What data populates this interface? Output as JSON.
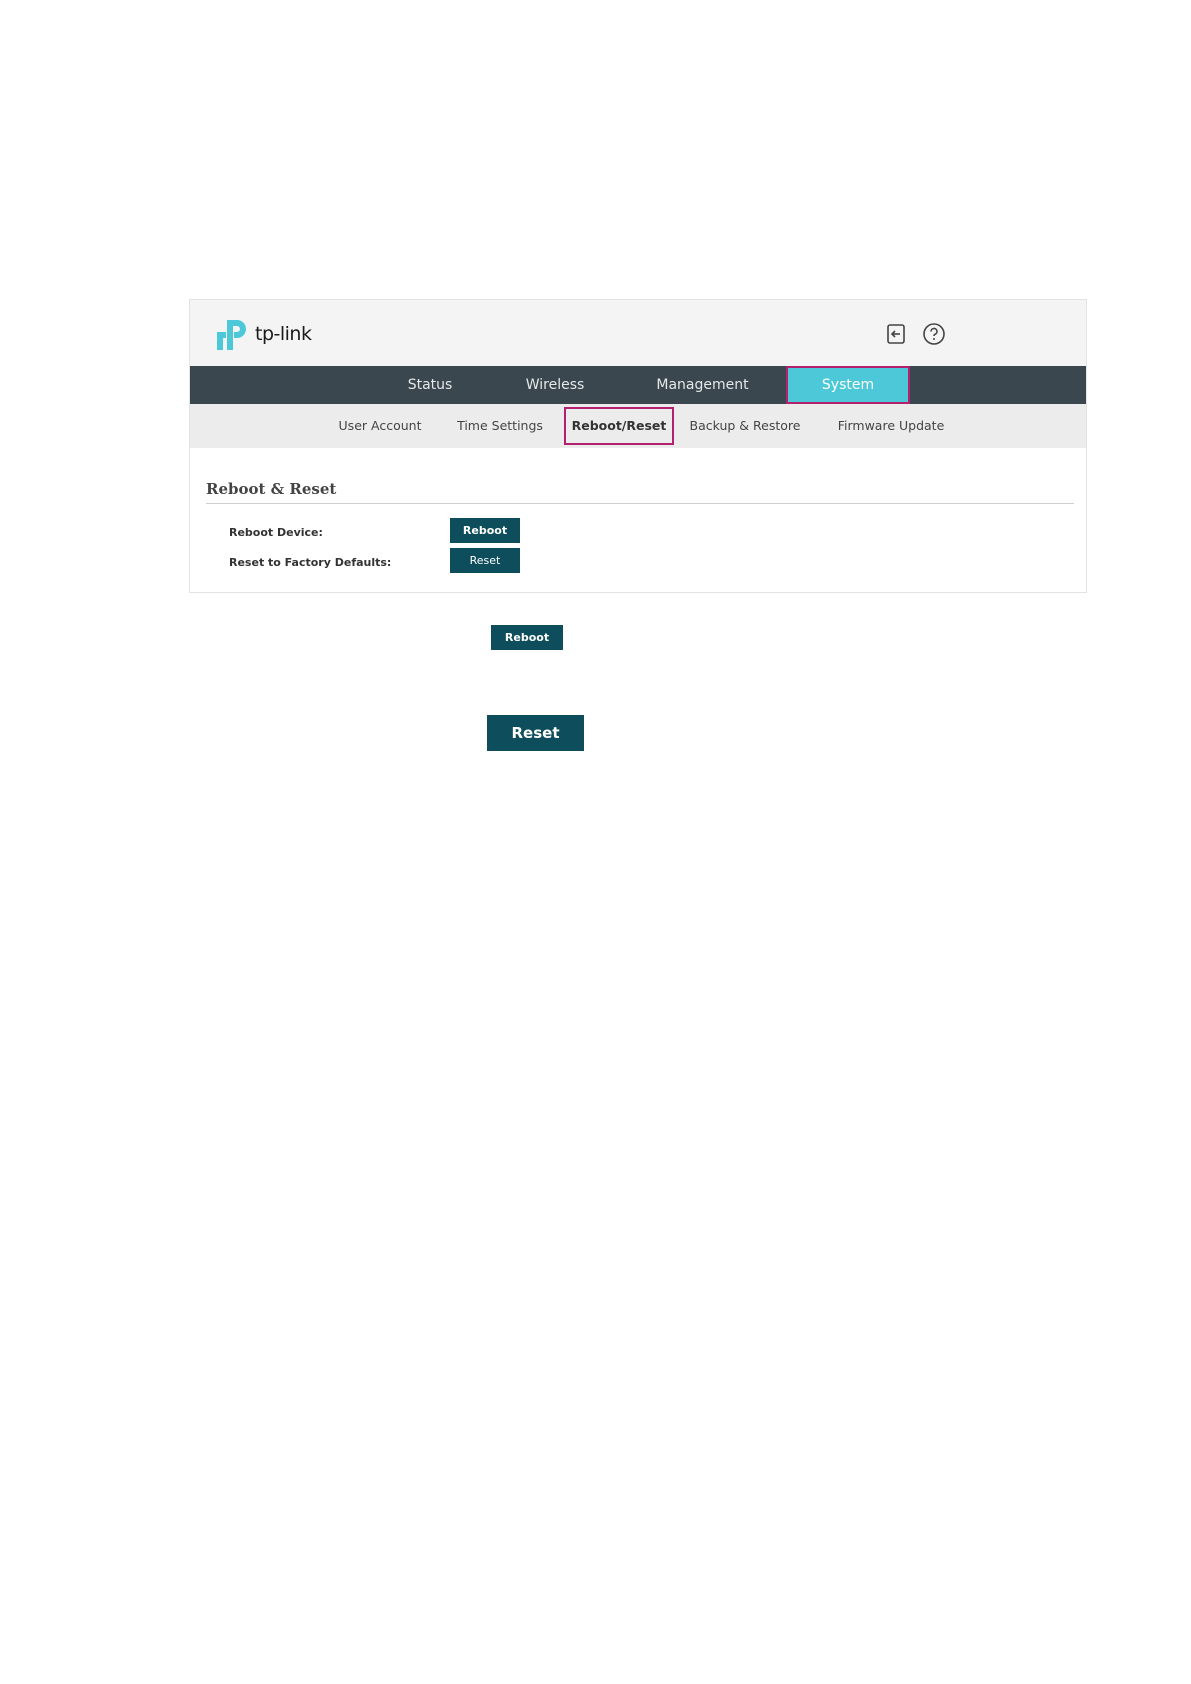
{
  "header": {
    "logo_text": "tp-link",
    "icons": [
      "logout-icon",
      "help-icon"
    ]
  },
  "main_nav": {
    "items": [
      {
        "label": "Status"
      },
      {
        "label": "Wireless"
      },
      {
        "label": "Management"
      },
      {
        "label": "System",
        "active": true
      }
    ]
  },
  "sub_nav": {
    "items": [
      {
        "label": "User Account"
      },
      {
        "label": "Time Settings"
      },
      {
        "label": "Reboot/Reset",
        "active": true
      },
      {
        "label": "Backup & Restore"
      },
      {
        "label": "Firmware Update"
      }
    ]
  },
  "section": {
    "title": "Reboot & Reset",
    "rows": [
      {
        "label": "Reboot Device:",
        "button": "Reboot"
      },
      {
        "label": "Reset to Factory Defaults:",
        "button": "Reset"
      }
    ]
  },
  "standalone": {
    "reboot_button": "Reboot",
    "reset_button": "Reset"
  },
  "colors": {
    "accent": "#4cc8d9",
    "highlight": "#b2206e",
    "button": "#0e4d5b",
    "nav": "#3a474e"
  }
}
